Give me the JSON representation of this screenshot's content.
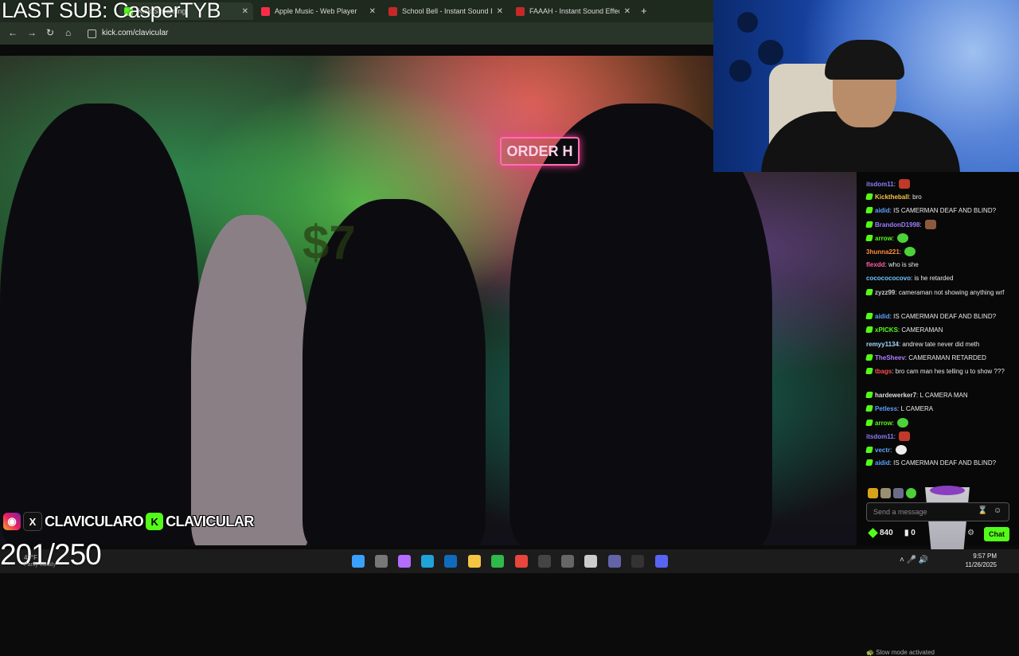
{
  "overlay": {
    "title": "LAST SUB: CasperTYB",
    "sub_count": "201/250",
    "handle_1": "CLAVICULARO",
    "handle_2": "CLAVICULAR"
  },
  "browser": {
    "tabs": [
      {
        "label": "Kick Streaming",
        "icon": "kick-favicon",
        "color": "#53fc18",
        "active": true
      },
      {
        "label": "Apple Music - Web Player",
        "icon": "apple-music-favicon",
        "color": "#fa2d48"
      },
      {
        "label": "School Bell - Instant Sound Effe",
        "icon": "myinstants-favicon",
        "color": "#c62828"
      },
      {
        "label": "FAAAH - Instant Sound Effect B",
        "icon": "myinstants-favicon",
        "color": "#c62828"
      }
    ],
    "url": "kick.com/clavicular",
    "nav_icons": [
      "back-icon",
      "forward-icon",
      "reload-icon",
      "home-icon"
    ]
  },
  "video": {
    "sign_text": "ORDER H",
    "price_text": "$7"
  },
  "chat": {
    "messages": [
      {
        "user": "itsdom11",
        "text": "",
        "user_color": "#8a7dff",
        "badge": false,
        "emote": "red"
      },
      {
        "user": "Kicktheball",
        "text": "bro",
        "user_color": "#f5c542",
        "badge": true
      },
      {
        "user": "aidid",
        "text": "IS CAMERMAN DEAF AND BLIND?",
        "user_color": "#5aa0ff",
        "badge": true
      },
      {
        "user": "BrandonD1998",
        "text": "",
        "user_color": "#9f7dff",
        "badge": true,
        "emote": "brown"
      },
      {
        "user": "arrow",
        "text": "",
        "user_color": "#53fc18",
        "badge": true,
        "emote": "green"
      },
      {
        "user": "3hunna221",
        "text": "",
        "user_color": "#ff8a3d",
        "badge": false,
        "emote": "green"
      },
      {
        "user": "flexdd",
        "text": "who is she",
        "user_color": "#ff5ca8",
        "badge": false
      },
      {
        "user": "cococococovo",
        "text": "is he retarded",
        "user_color": "#6ec6ff",
        "badge": false
      },
      {
        "user": "zyzz99",
        "text": "cameraman not showing anything wrf",
        "user_color": "#cfcfcf",
        "badge": true
      },
      {
        "user": "aidid",
        "text": "IS CAMERMAN DEAF AND BLIND?",
        "user_color": "#5aa0ff",
        "badge": true
      },
      {
        "user": "xPICKS",
        "text": "CAMERAMAN",
        "user_color": "#53fc18",
        "badge": true
      },
      {
        "user": "remyy1134",
        "text": "andrew tate never did meth",
        "user_color": "#a0d8ff",
        "badge": false
      },
      {
        "user": "TheSheev",
        "text": "CAMERAMAN RETARDED",
        "user_color": "#b07dff",
        "badge": true
      },
      {
        "user": "tbags",
        "text": "bro cam man hes telling u to show ???",
        "user_color": "#ff4d4d",
        "badge": true
      },
      {
        "user": "hardewerker7",
        "text": "L CAMERA MAN",
        "user_color": "#dddddd",
        "badge": true
      },
      {
        "user": "Petless",
        "text": "L CAMERA",
        "user_color": "#5aa0ff",
        "badge": true
      },
      {
        "user": "arrow",
        "text": "",
        "user_color": "#53fc18",
        "badge": true,
        "emote": "green"
      },
      {
        "user": "itsdom11",
        "text": "",
        "user_color": "#8a7dff",
        "badge": false,
        "emote": "red"
      },
      {
        "user": "vectr",
        "text": "",
        "user_color": "#5aa0ff",
        "badge": true,
        "emote": "white"
      },
      {
        "user": "aidid",
        "text": "IS CAMERMAN DEAF AND BLIND?",
        "user_color": "#5aa0ff",
        "badge": true
      }
    ],
    "slow_mode": "Slow mode activated",
    "input_placeholder": "Send a message",
    "points": "840",
    "gifts": "0",
    "chat_button": "Chat"
  },
  "taskbar": {
    "weather_temp": "47°F",
    "weather_desc": "Partly cloudy",
    "time": "9:57 PM",
    "date": "11/26/2025",
    "icons": [
      {
        "name": "windows-start-icon",
        "color": "#3aa0ff"
      },
      {
        "name": "task-view-icon",
        "color": "#777777"
      },
      {
        "name": "copilot-icon",
        "color": "#b46cff"
      },
      {
        "name": "edge-icon",
        "color": "#1fa3d8"
      },
      {
        "name": "outlook-icon",
        "color": "#0f6cbd"
      },
      {
        "name": "file-explorer-icon",
        "color": "#f5c542"
      },
      {
        "name": "xbox-icon",
        "color": "#2fb94a"
      },
      {
        "name": "chrome-icon",
        "color": "#e8453c"
      },
      {
        "name": "obs-icon",
        "color": "#444444"
      },
      {
        "name": "store-icon",
        "color": "#666666"
      },
      {
        "name": "alien-icon",
        "color": "#cccccc"
      },
      {
        "name": "app-icon",
        "color": "#333333"
      },
      {
        "name": "teams-icon",
        "color": "#6264a7"
      },
      {
        "name": "discord-icon",
        "color": "#5865f2"
      }
    ]
  }
}
